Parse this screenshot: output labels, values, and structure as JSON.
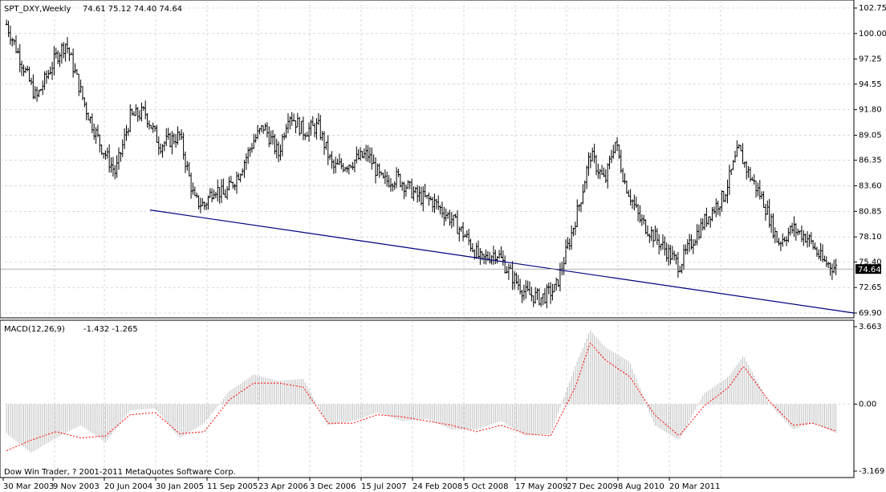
{
  "header": {
    "symbol": "SPT_DXY,Weekly",
    "ohlc": "74.61 75.12 74.40 74.64"
  },
  "macd_header": {
    "name": "MACD(12,26,9)",
    "values": "-1.432 -1.265"
  },
  "footer": {
    "copyright": "Dow Win Trader, ? 2001-2011 MetaQuotes Software Corp."
  },
  "current_price": {
    "label": "74.64",
    "value": 74.64
  },
  "colors": {
    "background": "#ffffff",
    "grid": "#c0c0c0",
    "candles": "#000000",
    "trendline": "#000080",
    "macd_histogram": "#c0c0c0",
    "signal_line": "#ff0000",
    "price_badge_bg": "#000000",
    "price_badge_text": "#ffffff"
  },
  "chart_data": [
    {
      "type": "ohlc",
      "ylim": [
        69.9,
        102.75
      ],
      "y_ticks": [
        "102.75",
        "100.00",
        "97.25",
        "94.55",
        "91.80",
        "89.05",
        "86.35",
        "83.60",
        "80.85",
        "78.10",
        "75.40",
        "72.65",
        "69.90"
      ],
      "y_tick_values": [
        102.75,
        100.0,
        97.25,
        94.55,
        91.8,
        89.05,
        86.35,
        83.6,
        80.85,
        78.1,
        75.4,
        72.65,
        69.9
      ],
      "x_ticks": [
        "30 Mar 2003",
        "9 Nov 2003",
        "20 Jun 2004",
        "30 Jan 2005",
        "11 Sep 2005",
        "23 Apr 2006",
        "3 Dec 2006",
        "15 Jul 2007",
        "24 Feb 2008",
        "5 Oct 2008",
        "17 May 2009",
        "27 Dec 2009",
        "8 Aug 2010",
        "20 Mar 2011"
      ],
      "series": [
        {
          "approx_closes": [
            [
              2003.05,
              101.0
            ],
            [
              2003.35,
              93.0
            ],
            [
              2003.55,
              97.5
            ],
            [
              2003.65,
              99.0
            ],
            [
              2003.85,
              92.0
            ],
            [
              2004.0,
              88.0
            ],
            [
              2004.15,
              85.0
            ],
            [
              2004.3,
              91.0
            ],
            [
              2004.45,
              91.5
            ],
            [
              2004.6,
              88.0
            ],
            [
              2004.8,
              89.0
            ],
            [
              2004.95,
              82.0
            ],
            [
              2005.05,
              81.5
            ],
            [
              2005.15,
              83.5
            ],
            [
              2005.25,
              82.5
            ],
            [
              2005.4,
              85.0
            ],
            [
              2005.55,
              88.5
            ],
            [
              2005.65,
              90.0
            ],
            [
              2005.8,
              87.0
            ],
            [
              2005.9,
              91.5
            ],
            [
              2006.05,
              89.5
            ],
            [
              2006.2,
              90.0
            ],
            [
              2006.35,
              85.5
            ],
            [
              2006.5,
              86.0
            ],
            [
              2006.7,
              87.0
            ],
            [
              2006.85,
              84.0
            ],
            [
              2007.0,
              84.5
            ],
            [
              2007.2,
              82.5
            ],
            [
              2007.35,
              82.0
            ],
            [
              2007.55,
              80.0
            ],
            [
              2007.7,
              78.0
            ],
            [
              2007.85,
              75.5
            ],
            [
              2008.0,
              76.5
            ],
            [
              2008.15,
              74.0
            ],
            [
              2008.3,
              72.0
            ],
            [
              2008.45,
              71.5
            ],
            [
              2008.6,
              72.5
            ],
            [
              2008.75,
              78.0
            ],
            [
              2008.85,
              82.0
            ],
            [
              2008.95,
              87.0
            ],
            [
              2009.1,
              84.0
            ],
            [
              2009.2,
              88.5
            ],
            [
              2009.3,
              84.0
            ],
            [
              2009.45,
              80.0
            ],
            [
              2009.65,
              77.5
            ],
            [
              2009.85,
              75.0
            ],
            [
              2010.0,
              78.0
            ],
            [
              2010.15,
              80.5
            ],
            [
              2010.3,
              82.5
            ],
            [
              2010.45,
              87.5
            ],
            [
              2010.55,
              85.0
            ],
            [
              2010.7,
              82.0
            ],
            [
              2010.85,
              77.5
            ],
            [
              2011.0,
              79.0
            ],
            [
              2011.15,
              78.0
            ],
            [
              2011.3,
              75.5
            ],
            [
              2011.45,
              74.64
            ]
          ]
        }
      ]
    },
    {
      "type": "line",
      "ylim": [
        -3.169,
        3.663
      ],
      "y_ticks": [
        "3.663",
        "0.00",
        "-3.169"
      ],
      "y_tick_values": [
        3.663,
        0.0,
        -3.169
      ],
      "series": [
        {
          "kind": "histogram",
          "x": [
            2003.05,
            2003.3,
            2003.55,
            2003.8,
            2004.05,
            2004.3,
            2004.55,
            2004.8,
            2005.05,
            2005.3,
            2005.55,
            2005.8,
            2006.05,
            2006.3,
            2006.55,
            2006.8,
            2007.05,
            2007.3,
            2007.55,
            2007.8,
            2008.05,
            2008.3,
            2008.55,
            2008.8,
            2008.95,
            2009.1,
            2009.35,
            2009.6,
            2009.85,
            2010.1,
            2010.35,
            2010.5,
            2010.75,
            2011.0,
            2011.2,
            2011.45
          ],
          "values": [
            -1.4,
            -2.3,
            -1.6,
            -1.0,
            -1.8,
            -0.3,
            -0.2,
            -1.6,
            -0.9,
            0.6,
            1.4,
            1.1,
            1.2,
            -1.0,
            -0.8,
            -0.4,
            -0.8,
            -0.7,
            -1.2,
            -1.2,
            -0.8,
            -1.5,
            -1.4,
            1.8,
            3.5,
            2.7,
            2.0,
            -1.0,
            -1.7,
            0.5,
            1.3,
            2.3,
            0.1,
            -1.2,
            -0.9,
            -1.4
          ]
        },
        {
          "kind": "signal",
          "x": [
            2003.05,
            2003.3,
            2003.55,
            2003.8,
            2004.05,
            2004.3,
            2004.55,
            2004.8,
            2005.05,
            2005.3,
            2005.55,
            2005.8,
            2006.05,
            2006.3,
            2006.55,
            2006.8,
            2007.05,
            2007.3,
            2007.55,
            2007.8,
            2008.05,
            2008.3,
            2008.55,
            2008.8,
            2008.95,
            2009.1,
            2009.35,
            2009.6,
            2009.85,
            2010.1,
            2010.35,
            2010.5,
            2010.75,
            2011.0,
            2011.2,
            2011.45
          ],
          "values": [
            -2.2,
            -1.7,
            -1.3,
            -1.6,
            -1.5,
            -0.5,
            -0.4,
            -1.4,
            -1.3,
            0.2,
            1.0,
            1.0,
            0.8,
            -0.9,
            -0.9,
            -0.5,
            -0.6,
            -0.8,
            -1.0,
            -1.3,
            -1.0,
            -1.4,
            -1.5,
            0.8,
            2.9,
            2.1,
            1.3,
            -0.5,
            -1.5,
            -0.1,
            0.8,
            1.8,
            0.2,
            -1.0,
            -0.9,
            -1.3
          ]
        }
      ]
    }
  ]
}
